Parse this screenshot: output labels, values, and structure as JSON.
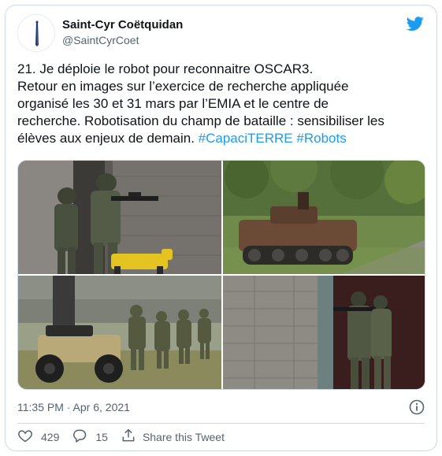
{
  "author": {
    "display_name": "Saint-Cyr Coëtquidan",
    "handle": "@SaintCyrCoet"
  },
  "tweet": {
    "lines": [
      "21. Je déploie le robot pour reconnaitre OSCAR3.",
      "Retour en images sur l’exercice de recherche appliquée",
      "organisé les 30 et 31 mars par l’EMIA et le centre de",
      "recherche. Robotisation du champ de bataille : sensibiliser les"
    ],
    "last_line_text": "élèves aux enjeux de demain. ",
    "hashtags": [
      "#CapaciTERRE",
      "#Robots"
    ]
  },
  "meta": {
    "timestamp": "11:35 PM · Apr 6, 2021"
  },
  "actions": {
    "likes": "429",
    "replies": "15",
    "share_label": "Share this Tweet"
  },
  "colors": {
    "accent": "#1d9bf0",
    "text": "#0f1419",
    "muted": "#536471",
    "border": "#cfd9de"
  },
  "icons": {
    "brand": "twitter-bird-icon",
    "info": "info-icon",
    "like": "heart-icon",
    "reply": "reply-icon",
    "share": "share-icon"
  }
}
